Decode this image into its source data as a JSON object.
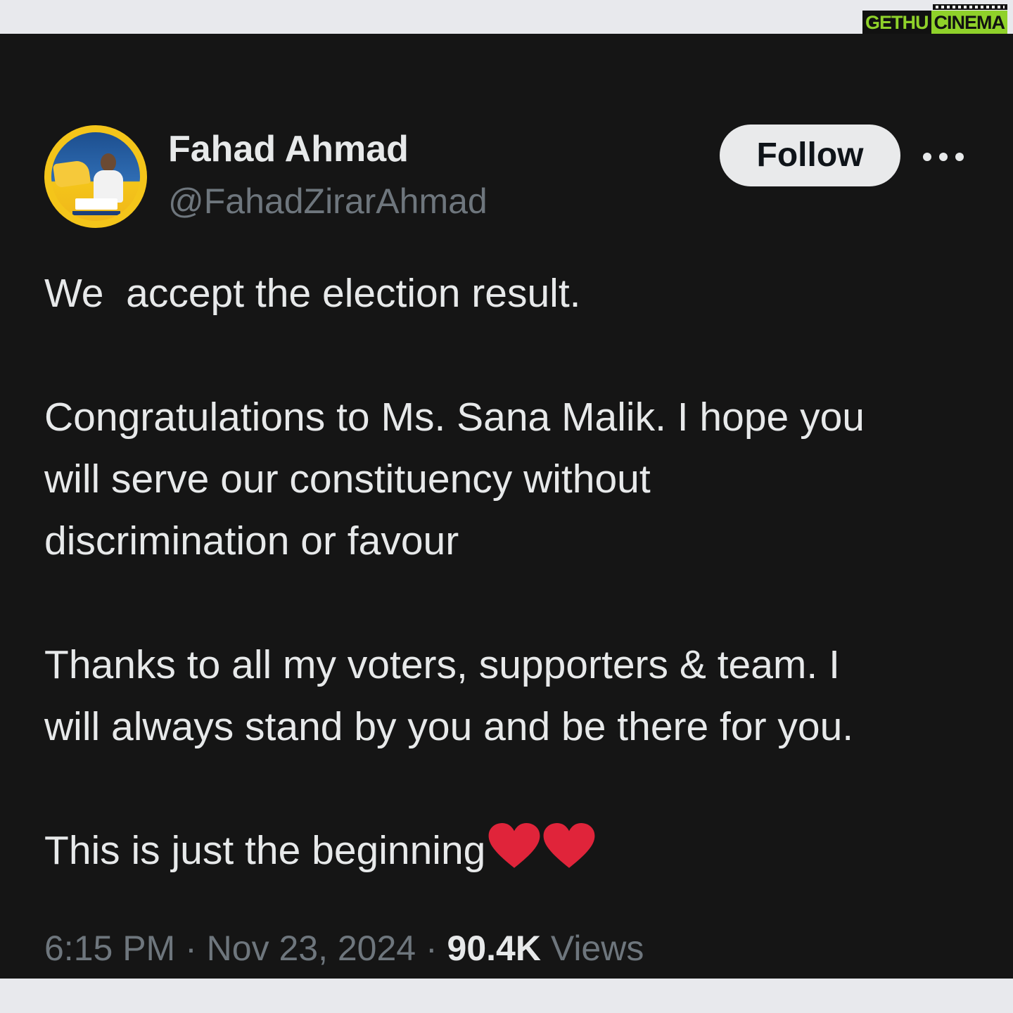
{
  "watermark": {
    "part1": "GETHU",
    "part2": "CINEMA"
  },
  "tweet": {
    "author_name": "Fahad Ahmad",
    "author_handle": "@FahadZirarAhmad",
    "follow_label": "Follow",
    "paragraphs": {
      "p1_l1": "We  accept the election result.",
      "p2_l1": "Congratulations to Ms. Sana Malik. I hope you",
      "p2_l2": "will serve our constituency without",
      "p2_l3": "discrimination or favour",
      "p3_l1": "Thanks to all my voters, supporters & team. I",
      "p3_l2": "will always stand by you and be there for you.",
      "p4_l1": "This is just the beginning"
    },
    "emoji": "❤️❤️",
    "time": "6:15 PM",
    "separator": " · ",
    "date": "Nov 23, 2024",
    "views_count": "90.4K",
    "views_label": "Views"
  },
  "colors": {
    "card_background": "#151515",
    "page_background": "#e8e9ed",
    "primary_text": "#e7e9ea",
    "secondary_text": "#6e767d",
    "heart": "#e0243a"
  }
}
